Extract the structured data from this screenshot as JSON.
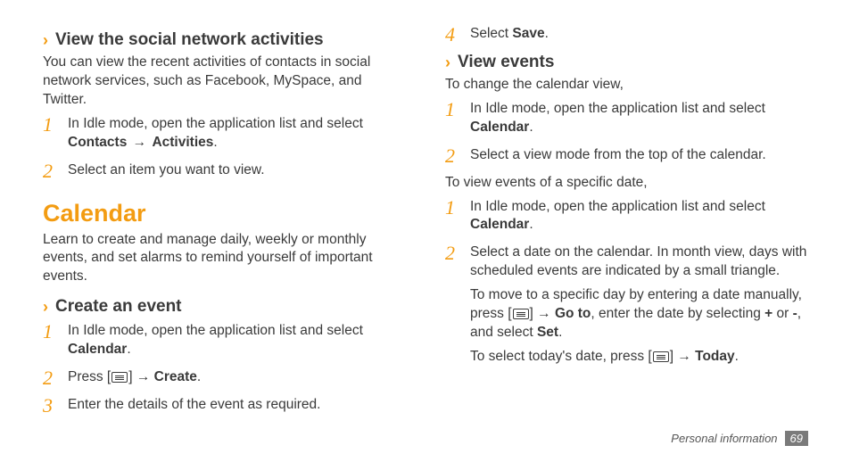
{
  "left": {
    "sub1": {
      "title": "View the social network activities",
      "intro": "You can view the recent activities of contacts in social network services, such as Facebook, MySpace, and Twitter.",
      "step1_pre": "In Idle mode, open the application list and select ",
      "step1_b1": "Contacts",
      "step1_arrow": " → ",
      "step1_b2": "Activities",
      "step1_post": ".",
      "step2": "Select an item you want to view."
    },
    "calendar": {
      "heading": "Calendar",
      "intro": "Learn to create and manage daily, weekly or monthly events, and set alarms to remind yourself of important events."
    },
    "sub2": {
      "title": "Create an event",
      "step1_pre": "In Idle mode, open the application list and select ",
      "step1_b1": "Calendar",
      "step1_post": ".",
      "step2_pre": "Press [",
      "step2_mid": "] → ",
      "step2_b1": "Create",
      "step2_post": ".",
      "step3": "Enter the details of the event as required."
    }
  },
  "right": {
    "step4_pre": "Select ",
    "step4_b1": "Save",
    "step4_post": ".",
    "sub3": {
      "title": "View events",
      "intro1": "To change the calendar view,",
      "a_step1_pre": "In Idle mode, open the application list and select ",
      "a_step1_b1": "Calendar",
      "a_step1_post": ".",
      "a_step2": "Select a view mode from the top of the calendar.",
      "intro2": "To view events of a specific date,",
      "b_step1_pre": "In Idle mode, open the application list and select ",
      "b_step1_b1": "Calendar",
      "b_step1_post": ".",
      "b_step2_l1": "Select a date on the calendar. In month view, days with scheduled events are indicated by a small triangle.",
      "b_step2_l2_pre": "To move to a specific day by entering a date manually, press [",
      "b_step2_l2_mid": "] → ",
      "b_step2_l2_b1": "Go to",
      "b_step2_l2_mid2": ", enter the date by selecting ",
      "b_step2_l2_b2": "+",
      "b_step2_l2_mid3": " or ",
      "b_step2_l2_b3": "-",
      "b_step2_l2_mid4": ", and select ",
      "b_step2_l2_b4": "Set",
      "b_step2_l2_post": ".",
      "b_step2_l3_pre": "To select today's date, press [",
      "b_step2_l3_mid": "] → ",
      "b_step2_l3_b1": "Today",
      "b_step2_l3_post": "."
    }
  },
  "footer": {
    "section": "Personal information",
    "page": "69"
  },
  "nums": {
    "n1": "1",
    "n2": "2",
    "n3": "3",
    "n4": "4"
  }
}
